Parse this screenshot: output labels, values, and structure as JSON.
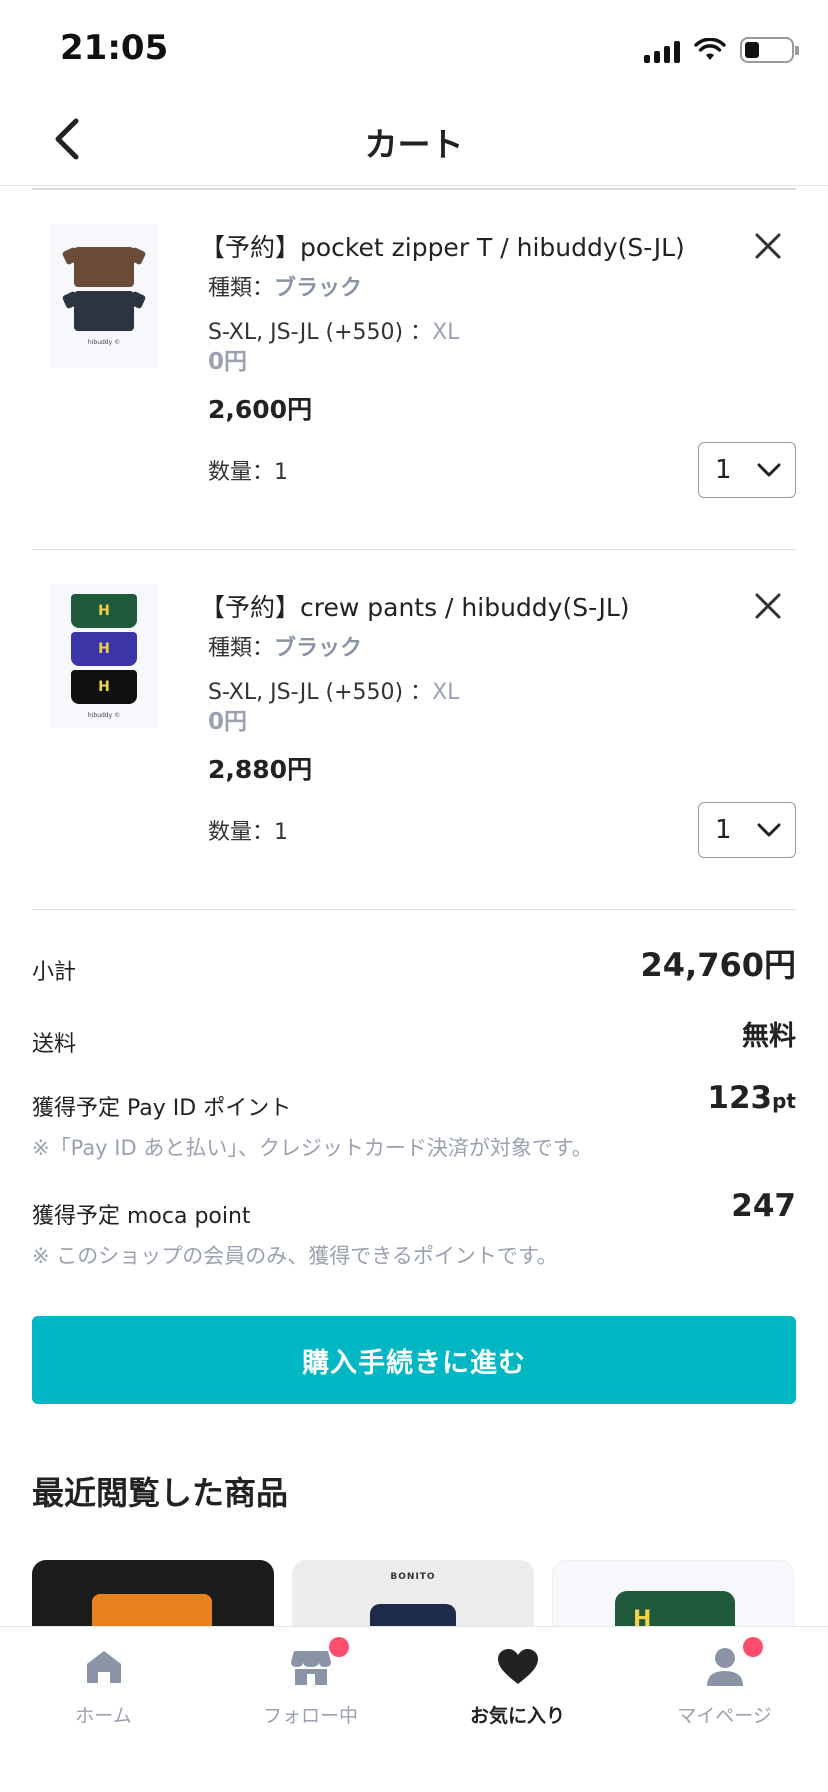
{
  "status_bar": {
    "time": "21:05"
  },
  "header": {
    "title": "カート"
  },
  "cart": {
    "items": [
      {
        "title": "【予約】pocket zipper T / hibuddy(S-JL)",
        "variant_label": "種類：",
        "variant_value": "ブラック",
        "option_label": "S-XL, JS-JL (+550) ：",
        "option_value": "XL",
        "option_price": "0円",
        "price": "2,600円",
        "qty_label": "数量：1",
        "qty_value": "1",
        "thumb_caption": "hibuddy ©"
      },
      {
        "title": "【予約】crew pants / hibuddy(S-JL)",
        "variant_label": "種類：",
        "variant_value": "ブラック",
        "option_label": "S-XL, JS-JL (+550) ：",
        "option_value": "XL",
        "option_price": "0円",
        "price": "2,880円",
        "qty_label": "数量：1",
        "qty_value": "1",
        "thumb_caption": "hibuddy ©"
      }
    ]
  },
  "summary": {
    "subtotal_label": "小計",
    "subtotal_value": "24,760円",
    "shipping_label": "送料",
    "shipping_value": "無料",
    "payid_label": "獲得予定 Pay ID ポイント",
    "payid_value": "123",
    "payid_unit": "pt",
    "payid_note": "※「Pay ID あと払い」、クレジットカード決済が対象です。",
    "moca_label": "獲得予定 moca point",
    "moca_value": "247",
    "moca_note": "※ このショップの会員のみ、獲得できるポイントです。"
  },
  "checkout": {
    "label": "購入手続きに進む"
  },
  "recent": {
    "heading": "最近閲覧した商品",
    "card_brand": "BONITO",
    "card_letter": "H"
  },
  "tabbar": {
    "items": [
      {
        "label": "ホーム",
        "icon": "home-icon"
      },
      {
        "label": "フォロー中",
        "icon": "store-icon"
      },
      {
        "label": "お気に入り",
        "icon": "heart-icon"
      },
      {
        "label": "マイページ",
        "icon": "user-icon"
      }
    ]
  },
  "colors": {
    "accent": "#00b7c3",
    "muted": "#9aa2b1",
    "badge": "#ff4d6d"
  }
}
